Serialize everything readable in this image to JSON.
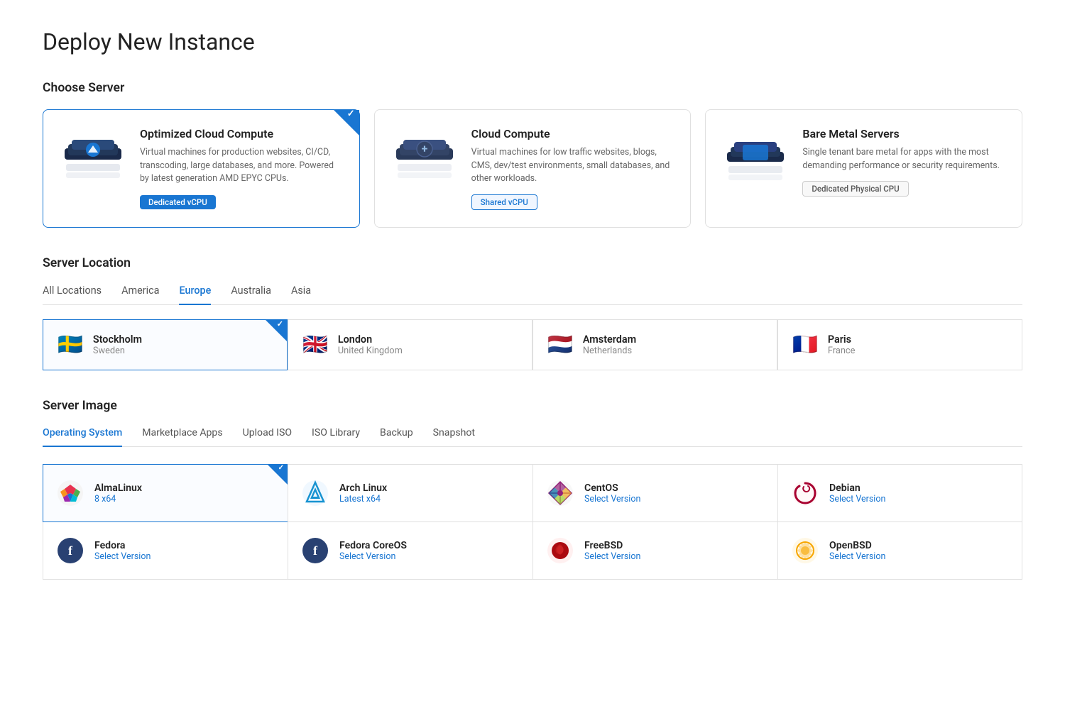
{
  "page": {
    "title": "Deploy New Instance"
  },
  "serverType": {
    "heading": "Choose Server",
    "cards": [
      {
        "id": "optimized",
        "title": "Optimized Cloud Compute",
        "desc": "Virtual machines for production websites, CI/CD, transcoding, large databases, and more. Powered by latest generation AMD EPYC CPUs.",
        "badge": "Dedicated vCPU",
        "badgeStyle": "blue",
        "selected": true
      },
      {
        "id": "cloud",
        "title": "Cloud Compute",
        "desc": "Virtual machines for low traffic websites, blogs, CMS, dev/test environments, small databases, and other workloads.",
        "badge": "Shared vCPU",
        "badgeStyle": "outline-blue",
        "selected": false
      },
      {
        "id": "bare",
        "title": "Bare Metal Servers",
        "desc": "Single tenant bare metal for apps with the most demanding performance or security requirements.",
        "badge": "Dedicated Physical CPU",
        "badgeStyle": "outline-gray",
        "selected": false
      }
    ]
  },
  "serverLocation": {
    "heading": "Server Location",
    "tabs": [
      {
        "id": "all",
        "label": "All Locations",
        "active": false
      },
      {
        "id": "america",
        "label": "America",
        "active": false
      },
      {
        "id": "europe",
        "label": "Europe",
        "active": true
      },
      {
        "id": "australia",
        "label": "Australia",
        "active": false
      },
      {
        "id": "asia",
        "label": "Asia",
        "active": false
      }
    ],
    "locations": [
      {
        "id": "stockholm",
        "city": "Stockholm",
        "country": "Sweden",
        "flag": "🇸🇪",
        "selected": true
      },
      {
        "id": "london",
        "city": "London",
        "country": "United Kingdom",
        "flag": "🇬🇧",
        "selected": false
      },
      {
        "id": "amsterdam",
        "city": "Amsterdam",
        "country": "Netherlands",
        "flag": "🇳🇱",
        "selected": false
      },
      {
        "id": "paris",
        "city": "Paris",
        "country": "France",
        "flag": "🇫🇷",
        "selected": false
      }
    ]
  },
  "serverImage": {
    "heading": "Server Image",
    "tabs": [
      {
        "id": "os",
        "label": "Operating System",
        "active": true
      },
      {
        "id": "marketplace",
        "label": "Marketplace Apps",
        "active": false
      },
      {
        "id": "upload-iso",
        "label": "Upload ISO",
        "active": false
      },
      {
        "id": "iso-library",
        "label": "ISO Library",
        "active": false
      },
      {
        "id": "backup",
        "label": "Backup",
        "active": false
      },
      {
        "id": "snapshot",
        "label": "Snapshot",
        "active": false
      }
    ],
    "osCards": [
      {
        "id": "almalinux",
        "name": "AlmaLinux",
        "version": "8  x64",
        "selected": true,
        "color": "#e8324e"
      },
      {
        "id": "archlinux",
        "name": "Arch Linux",
        "version": "Latest  x64",
        "selected": false,
        "color": "#1793d1"
      },
      {
        "id": "centos",
        "name": "CentOS",
        "version": "Select Version",
        "selected": false,
        "color": "#932279"
      },
      {
        "id": "debian",
        "name": "Debian",
        "version": "Select Version",
        "selected": false,
        "color": "#a80030"
      },
      {
        "id": "fedora",
        "name": "Fedora",
        "version": "Select Version",
        "selected": false,
        "color": "#294172"
      },
      {
        "id": "fedora-coreos",
        "name": "Fedora CoreOS",
        "version": "Select Version",
        "selected": false,
        "color": "#294172"
      },
      {
        "id": "freebsd",
        "name": "FreeBSD",
        "version": "Select Version",
        "selected": false,
        "color": "#ab0a10"
      },
      {
        "id": "openbsd",
        "name": "OpenBSD",
        "version": "Select Version",
        "selected": false,
        "color": "#f7a600"
      }
    ]
  }
}
